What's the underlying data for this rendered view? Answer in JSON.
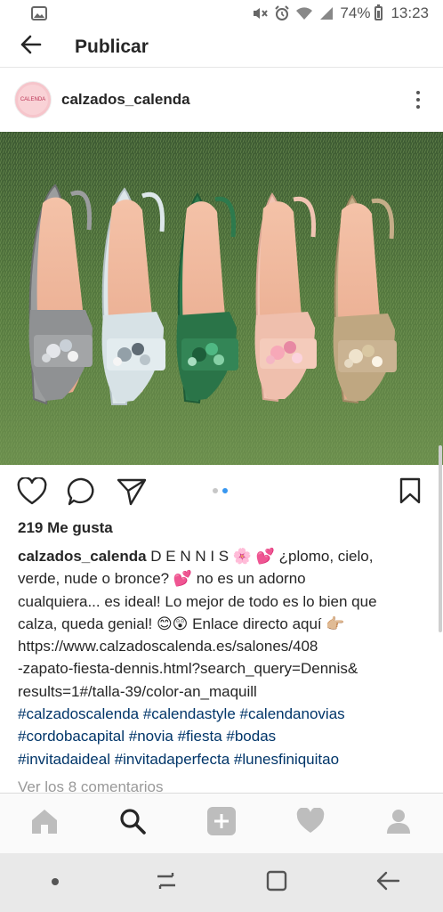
{
  "status_bar": {
    "battery": "74%",
    "time": "13:23",
    "icons": [
      "image-icon",
      "mute-icon",
      "alarm-icon",
      "wifi-icon",
      "signal-icon",
      "battery-icon"
    ]
  },
  "header": {
    "title": "Publicar",
    "back_icon": "arrow-left-icon"
  },
  "post": {
    "username": "calzados_calenda",
    "avatar_text": "CALENDA",
    "image_description_colors": [
      "#8a8c8e",
      "#dfe8ea",
      "#2e7a4e",
      "#f0c5b6",
      "#c2ab86"
    ],
    "likes": "219 Me gusta",
    "caption": {
      "username": "calzados_calenda",
      "line1_text": " D E N N I S 🌸 💕 ¿plomo, cielo,",
      "line2": "verde, nude o bronce? 💕 no es un adorno",
      "line3": "cualquiera... es ideal! Lo mejor de todo es lo bien que",
      "line4": "calza, queda genial! 😊😲 Enlace directo aquí 👉🏼",
      "line5": "https://www.calzadoscalenda.es/salones/408",
      "line6": "-zapato-fiesta-dennis.html?search_query=Dennis&",
      "line7": "results=1#/talla-39/color-an_maquill",
      "hashtags_line1": "#calzadoscalenda #calendastyle #calendanovias",
      "hashtags_line2": "#cordobacapital #novia #fiesta #bodas",
      "hashtags_line3": "#invitadaideal #invitadaperfecta #lunesfiniquitao"
    },
    "comments_link": "Ver los 8 comentarios"
  },
  "colors": {
    "accent": "#3897f0",
    "hashtag": "#003569",
    "muted": "#999999"
  }
}
